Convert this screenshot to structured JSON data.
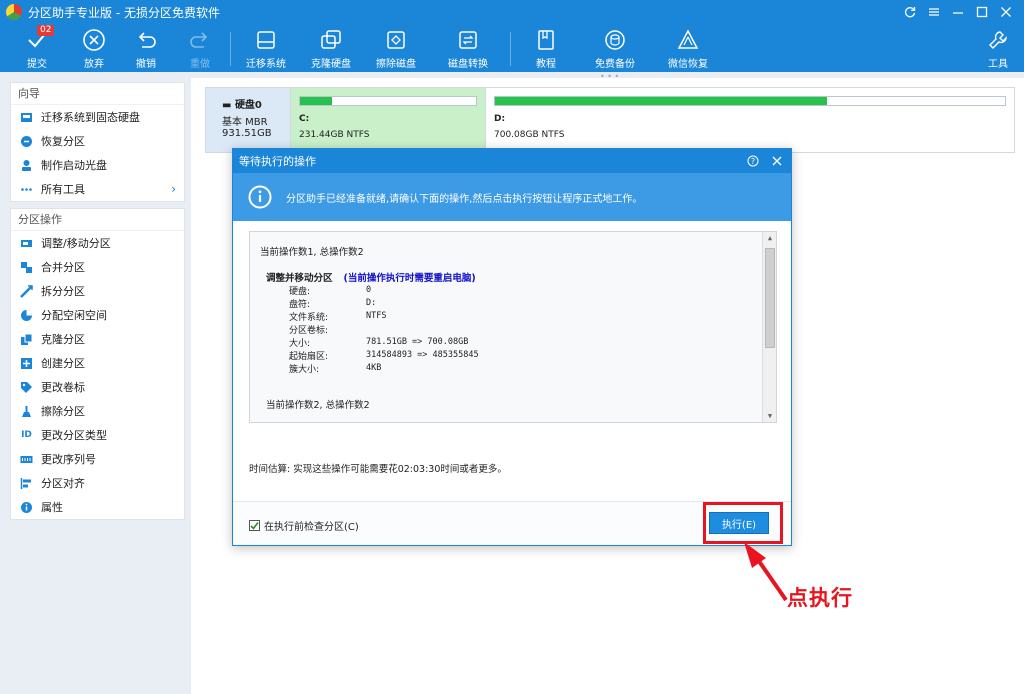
{
  "app": {
    "title": "分区助手专业版 - 无损分区免费软件"
  },
  "toolbar": {
    "commit": "提交",
    "commit_badge": "02",
    "discard": "放弃",
    "undo": "撤销",
    "redo": "重做",
    "migrate_os": "迁移系统",
    "clone_disk": "克隆硬盘",
    "wipe_disk": "擦除磁盘",
    "convert_disk": "磁盘转换",
    "tutorial": "教程",
    "free_backup": "免费备份",
    "wechat_restore": "微信恢复",
    "tools": "工具"
  },
  "sidebar": {
    "wizard_title": "向导",
    "wizard_items": [
      {
        "label": "迁移系统到固态硬盘"
      },
      {
        "label": "恢复分区"
      },
      {
        "label": "制作启动光盘"
      },
      {
        "label": "所有工具"
      }
    ],
    "ops_title": "分区操作",
    "ops_items": [
      {
        "label": "调整/移动分区"
      },
      {
        "label": "合并分区"
      },
      {
        "label": "拆分分区"
      },
      {
        "label": "分配空闲空间"
      },
      {
        "label": "克隆分区"
      },
      {
        "label": "创建分区"
      },
      {
        "label": "更改卷标"
      },
      {
        "label": "擦除分区"
      },
      {
        "label": "更改分区类型"
      },
      {
        "label": "更改序列号"
      },
      {
        "label": "分区对齐"
      },
      {
        "label": "属性"
      }
    ]
  },
  "disk": {
    "name": "硬盘0",
    "type": "基本 MBR",
    "size": "931.51GB",
    "partitions": [
      {
        "letter": "C:",
        "info": "231.44GB NTFS",
        "used_fraction": 0.18
      },
      {
        "letter": "D:",
        "info": "700.08GB NTFS",
        "used_fraction": 0.65
      }
    ]
  },
  "dialog": {
    "title": "等待执行的操作",
    "banner": "分区助手已经准备就绪,请确认下面的操作,然后点击执行按钮让程序正式地工作。",
    "op1_header": "当前操作数1, 总操作数2",
    "op1_title": "调整并移动分区",
    "op1_warning": "(当前操作执行时需要重启电脑)",
    "op1_fields": [
      {
        "key": "硬盘:",
        "value": "0"
      },
      {
        "key": "盘符:",
        "value": "D:"
      },
      {
        "key": "文件系统:",
        "value": "NTFS"
      },
      {
        "key": "分区卷标:",
        "value": ""
      },
      {
        "key": "大小:",
        "value": "781.51GB => 700.08GB"
      },
      {
        "key": "起始扇区:",
        "value": "314584893 => 485355845"
      },
      {
        "key": "簇大小:",
        "value": "4KB"
      }
    ],
    "op2_header": "当前操作数2, 总操作数2",
    "estimate": "时间估算: 实现这些操作可能需要花02:03:30时间或者更多。",
    "check_label": "在执行前检查分区(C)",
    "execute_label": "执行(E)"
  },
  "annotation": {
    "callout": "点执行"
  },
  "colors": {
    "accent": "#1b86d8",
    "highlight": "#e8141e",
    "partition_fill": "#27c24c"
  }
}
